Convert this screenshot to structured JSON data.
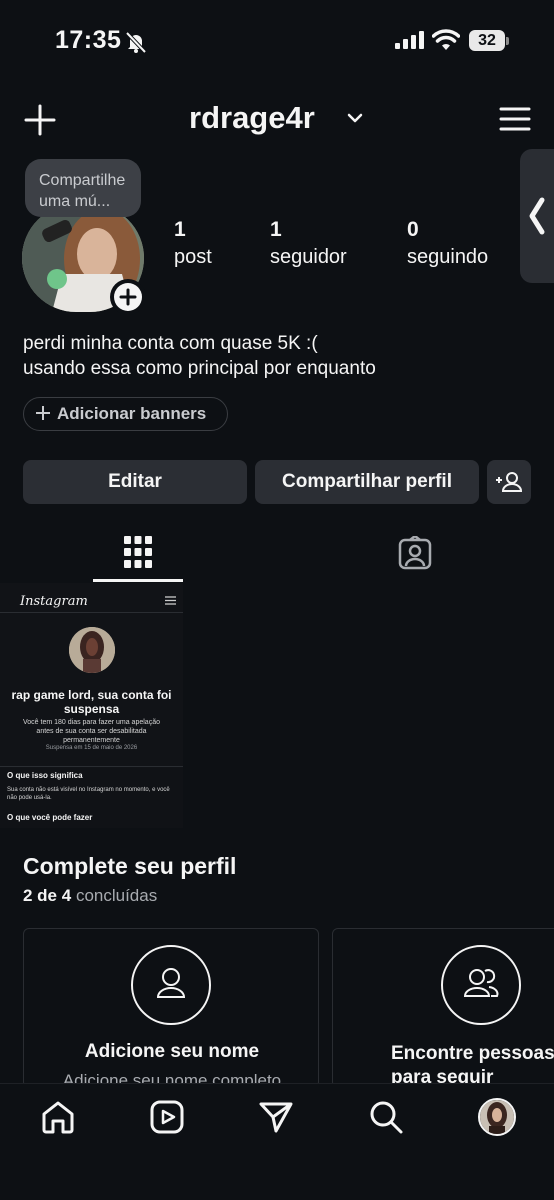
{
  "status_bar": {
    "time": "17:35",
    "battery": "32"
  },
  "header": {
    "username": "rdrage4r"
  },
  "note": {
    "text": "Compartilhe uma mú..."
  },
  "stats": [
    {
      "value": "1",
      "label": "post"
    },
    {
      "value": "1",
      "label": "seguidor"
    },
    {
      "value": "0",
      "label": "seguindo"
    }
  ],
  "bio": {
    "line1": "perdi minha conta com quase 5K :(",
    "line2": "usando essa como principal por enquanto"
  },
  "banner_button": "Adicionar banners",
  "actions": {
    "edit": "Editar",
    "share": "Compartilhar perfil"
  },
  "post": {
    "app_name": "Instagram",
    "headline": "rap game lord, sua conta foi suspensa",
    "body": "Você tem 180 dias para fazer uma apelação antes de sua conta ser desabilitada permanentemente",
    "date_text": "Suspensa em 15 de maio de 2026",
    "section1_title": "O que isso significa",
    "section1_body": "Sua conta não está visível no Instagram no momento, e você não pode usá-la.",
    "section2_title": "O que você pode fazer"
  },
  "complete_profile": {
    "title": "Complete seu perfil",
    "progress_count": "2 de 4",
    "progress_label": "concluídas",
    "cards": [
      {
        "icon": "person-icon",
        "title": "Adicione seu nome",
        "subtitle": "Adicione seu nome completo"
      },
      {
        "icon": "people-icon",
        "title": "Encontre pessoas para seguir",
        "subtitle": ""
      }
    ]
  },
  "colors": {
    "background": "#0d1014",
    "button": "#2b2e34",
    "text": "#f5f5f5",
    "muted": "#a8abb0"
  }
}
